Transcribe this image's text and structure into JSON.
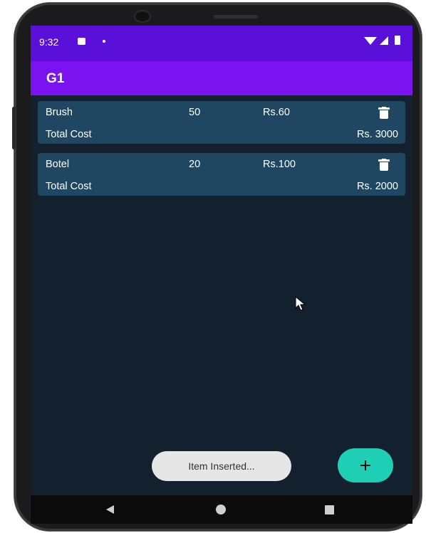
{
  "status_bar": {
    "time": "9:32"
  },
  "app_bar": {
    "title": "G1"
  },
  "items": [
    {
      "name": "Brush",
      "quantity": "50",
      "price": "Rs.60",
      "total_label": "Total Cost",
      "total_value": "Rs. 3000"
    },
    {
      "name": "Botel",
      "quantity": "20",
      "price": "Rs.100",
      "total_label": "Total Cost",
      "total_value": "Rs. 2000"
    }
  ],
  "toast": {
    "message": "Item Inserted..."
  },
  "icons": {
    "delete": "trash-icon",
    "fab": "plus-icon",
    "nav": [
      "back-icon",
      "home-icon",
      "recents-icon"
    ]
  },
  "colors": {
    "status_bar": "#5a10d9",
    "app_bar": "#7b12f0",
    "background": "#13212f",
    "card": "#1f4762",
    "fab": "#1ecfb5",
    "toast": "#e6e6e6"
  }
}
